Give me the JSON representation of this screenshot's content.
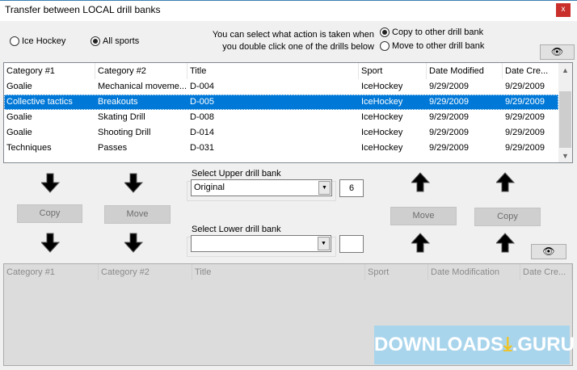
{
  "window": {
    "title": "Transfer between LOCAL drill banks",
    "close_label": "x"
  },
  "filter": {
    "options": [
      {
        "label": "Ice Hockey",
        "checked": false
      },
      {
        "label": "All sports",
        "checked": true
      }
    ]
  },
  "action": {
    "hint_line1": "You can select what action is taken when",
    "hint_line2": "you double click one of the drills below",
    "options": [
      {
        "label": "Copy to other drill bank",
        "checked": true
      },
      {
        "label": "Move to other drill bank",
        "checked": false
      }
    ]
  },
  "upper_list": {
    "columns": [
      "Category #1",
      "Category #2",
      "Title",
      "Sport",
      "Date Modified",
      "Date Cre..."
    ],
    "rows": [
      [
        "Goalie",
        "Mechanical moveme...",
        "D-004",
        "IceHockey",
        "9/29/2009",
        "9/29/2009"
      ],
      [
        "Collective tactics",
        "Breakouts",
        "D-005",
        "IceHockey",
        "9/29/2009",
        "9/29/2009"
      ],
      [
        "Goalie",
        "Skating Drill",
        "D-008",
        "IceHockey",
        "9/29/2009",
        "9/29/2009"
      ],
      [
        "Goalie",
        "Shooting Drill",
        "D-014",
        "IceHockey",
        "9/29/2009",
        "9/29/2009"
      ],
      [
        "Techniques",
        "Passes",
        "D-031",
        "IceHockey",
        "9/29/2009",
        "9/29/2009"
      ]
    ],
    "selected_row": 1
  },
  "lower_list": {
    "columns": [
      "Category #1",
      "Category #2",
      "Title",
      "Sport",
      "Date Modification",
      "Date Cre..."
    ]
  },
  "buttons": {
    "copy_down": "Copy",
    "move_down": "Move",
    "move_up": "Move",
    "copy_up": "Copy"
  },
  "upper_bank": {
    "label": "Select Upper drill bank",
    "value": "Original",
    "count": "6"
  },
  "lower_bank": {
    "label": "Select Lower drill bank",
    "value": "",
    "count": ""
  },
  "icons": {
    "eye": "eye-icon",
    "arrow_down": "arrow-down-icon",
    "arrow_up": "arrow-up-icon"
  },
  "watermark": {
    "text_left": "DOWNLOADS",
    "text_right": ".GURU"
  }
}
